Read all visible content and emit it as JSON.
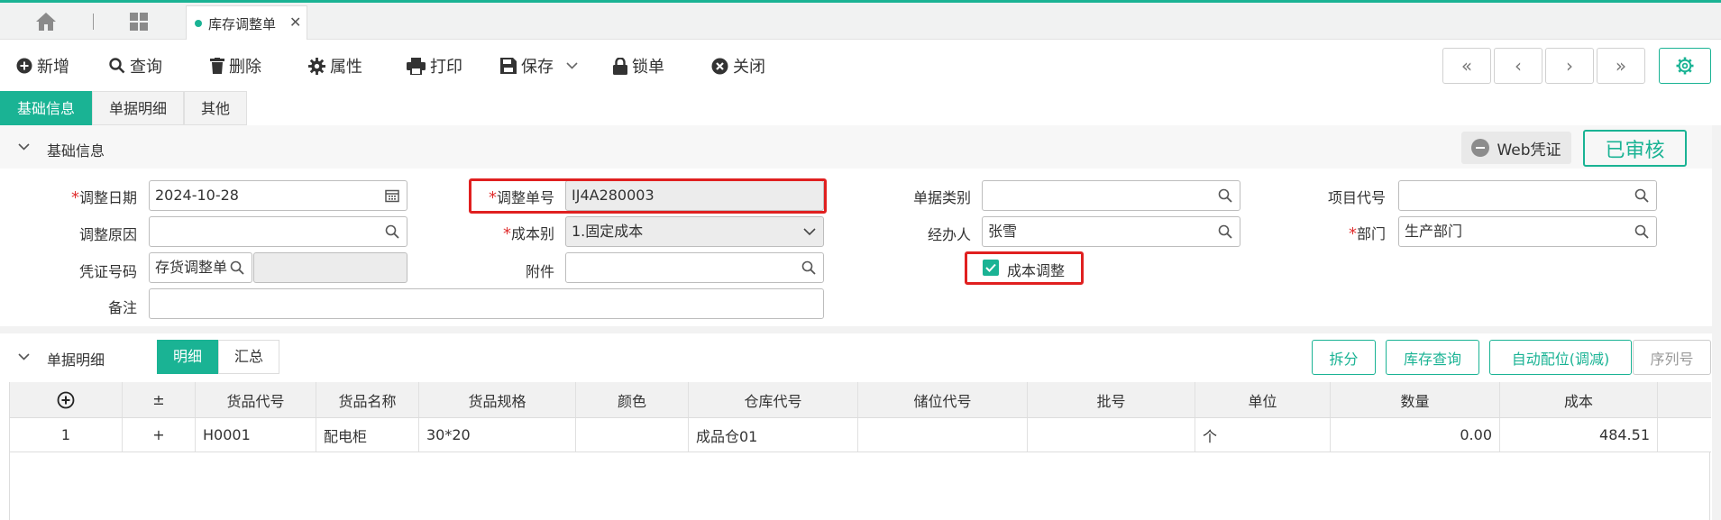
{
  "colors": {
    "accent": "#1ab394",
    "highlight": "#e02020",
    "required": "#e03030"
  },
  "tabbar": {
    "home_icon": "home-icon",
    "apps_icon": "grid-icon",
    "active_tab": {
      "title": "库存调整单",
      "close": "✕"
    }
  },
  "toolbar": {
    "items": [
      {
        "label": "新增",
        "icon": "plus-circle-icon"
      },
      {
        "label": "查询",
        "icon": "search-icon"
      },
      {
        "label": "删除",
        "icon": "trash-icon"
      },
      {
        "label": "属性",
        "icon": "gear-icon"
      },
      {
        "label": "打印",
        "icon": "printer-icon"
      },
      {
        "label": "保存",
        "icon": "save-icon"
      },
      {
        "label": "锁单",
        "icon": "lock-icon"
      },
      {
        "label": "关闭",
        "icon": "close-circle-icon"
      }
    ],
    "nav": {
      "first": "«",
      "prev": "‹",
      "next": "›",
      "last": "»"
    }
  },
  "subtabs": [
    "基础信息",
    "单据明细",
    "其他"
  ],
  "basic_section": {
    "title": "基础信息",
    "web_voucher_label": "Web凭证",
    "approved_label": "已审核"
  },
  "form": {
    "adjust_date": {
      "label": "调整日期",
      "value": "2024-10-28"
    },
    "adjust_no": {
      "label": "调整单号",
      "value": "IJ4A280003"
    },
    "bill_type": {
      "label": "单据类别",
      "value": ""
    },
    "project_code": {
      "label": "项目代号",
      "value": ""
    },
    "adjust_reason": {
      "label": "调整原因",
      "value": ""
    },
    "cost_type": {
      "label": "成本别",
      "value": "1.固定成本"
    },
    "handler": {
      "label": "经办人",
      "value": "张雪"
    },
    "department": {
      "label": "部门",
      "value": "生产部门"
    },
    "voucher_no": {
      "label": "凭证号码",
      "value": "存货调整单",
      "extra": ""
    },
    "attachment": {
      "label": "附件",
      "value": ""
    },
    "cost_adjust": {
      "label": "成本调整",
      "checked": true
    },
    "remark": {
      "label": "备注",
      "value": ""
    },
    "required_mark": "*"
  },
  "detail_section": {
    "title": "单据明细",
    "segments": [
      "明细",
      "汇总"
    ],
    "buttons": [
      "拆分",
      "库存查询",
      "自动配位(调减)",
      "序列号"
    ]
  },
  "grid": {
    "add_icon": "plus-circle-icon",
    "columns": [
      "±",
      "货品代号",
      "货品名称",
      "货品规格",
      "颜色",
      "仓库代号",
      "储位代号",
      "批号",
      "单位",
      "数量",
      "成本"
    ],
    "rows": [
      {
        "no": "1",
        "pm": "+",
        "code": "H0001",
        "name": "配电柜",
        "spec": "30*20",
        "color": "",
        "warehouse": "成品仓01",
        "location": "",
        "batch": "",
        "unit": "个",
        "qty": "0.00",
        "cost": "484.51"
      }
    ]
  }
}
